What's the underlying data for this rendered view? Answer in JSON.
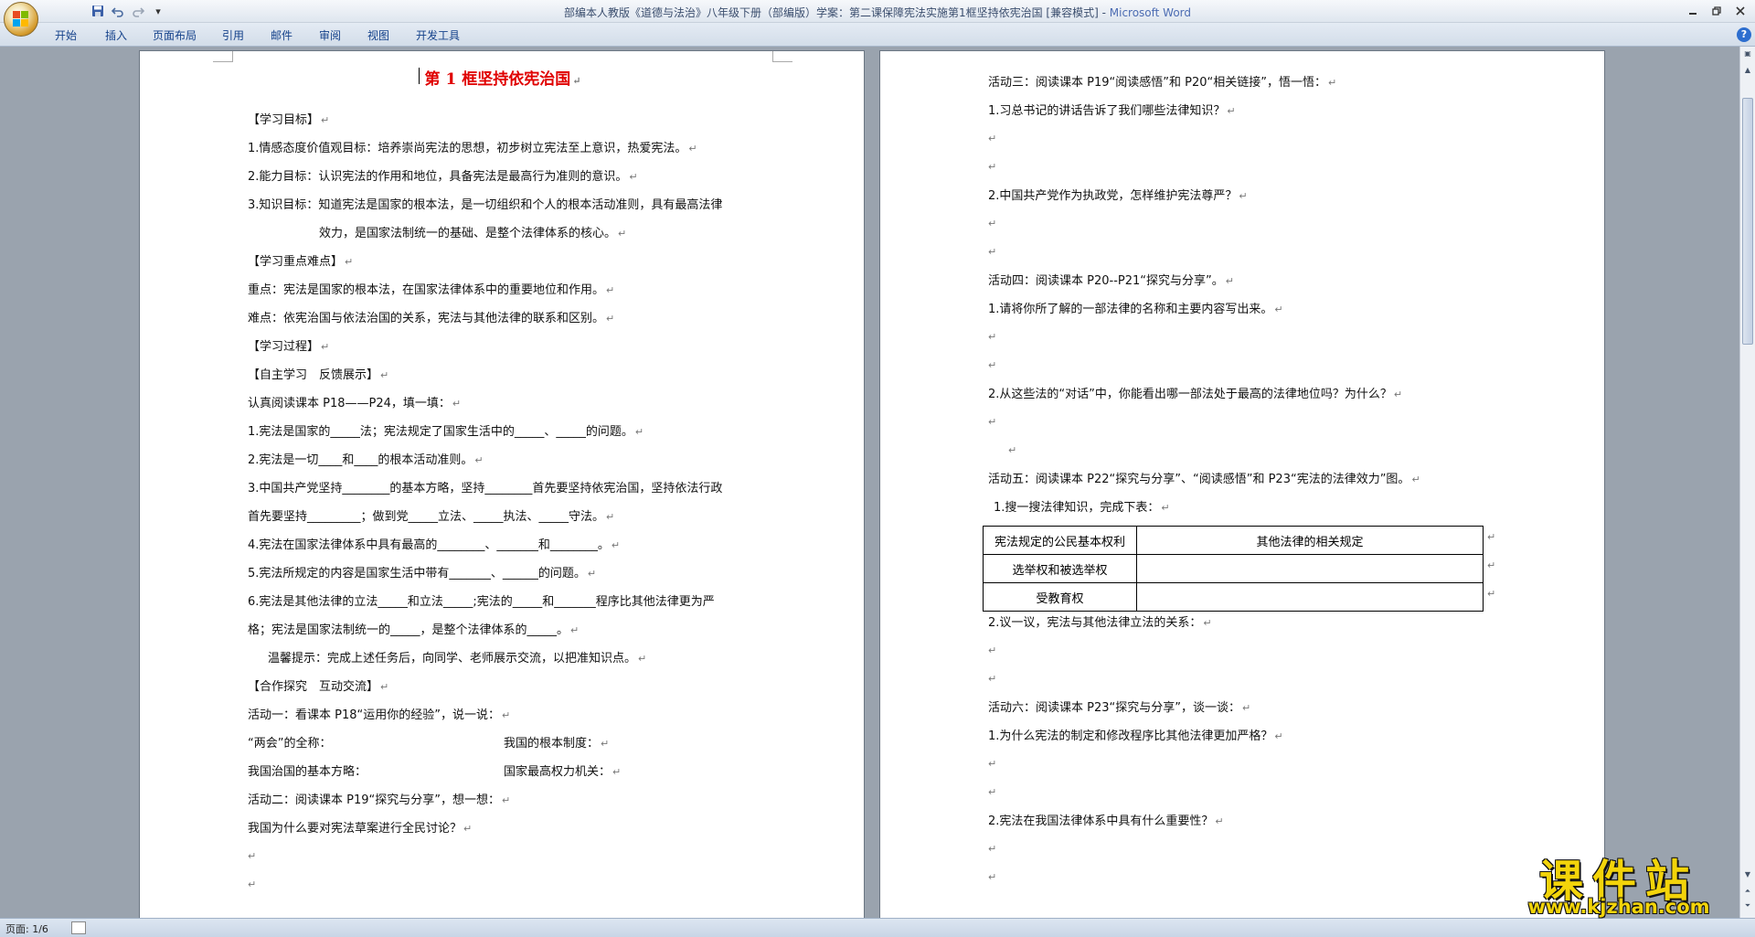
{
  "window": {
    "title_doc": "部编本人教版《道德与法治》八年级下册（部编版）学案：第二课保障宪法实施第1框坚持依宪治国 [兼容模式]",
    "title_sep": " - ",
    "title_app": "Microsoft Word"
  },
  "ribbon": {
    "tabs": [
      "开始",
      "插入",
      "页面布局",
      "引用",
      "邮件",
      "审阅",
      "视图",
      "开发工具"
    ]
  },
  "status": {
    "page": "页面: 1/6"
  },
  "page1": {
    "title": "第 1 框坚持依宪治国",
    "lines": [
      "【学习目标】",
      "1.情感态度价值观目标：培养崇尚宪法的思想，初步树立宪法至上意识，热爱宪法。",
      "2.能力目标：认识宪法的作用和地位，具备宪法是最高行为准则的意识。",
      "3.知识目标：知道宪法是国家的根本法，是一切组织和个人的根本活动准则，具有最高法律",
      "效力，是国家法制统一的基础、是整个法律体系的核心。",
      "【学习重点难点】",
      "重点：宪法是国家的根本法，在国家法律体系中的重要地位和作用。",
      "难点：依宪治国与依法治国的关系，宪法与其他法律的联系和区别。",
      "【学习过程】",
      "【自主学习　反馈展示】",
      "认真阅读课本 P18——P24，填一填：",
      "1.宪法是国家的_____法；宪法规定了国家生活中的_____、_____的问题。",
      "2.宪法是一切____和____的根本活动准则。",
      "3.中国共产党坚持________的基本方略，坚持________首先要坚持依宪治国，坚持依法行政",
      "首先要坚持_________；做到党_____立法、_____执法、_____守法。",
      "4.宪法在国家法律体系中具有最高的________、_______和________。",
      "5.宪法所规定的内容是国家生活中带有_______、______的问题。",
      "6.宪法是其他法律的立法_____和立法_____;宪法的_____和_______程序比其他法律更为严",
      "格；宪法是国家法制统一的_____，是整个法律体系的_____。",
      "温馨提示：完成上述任务后，向同学、老师展示交流，以把准知识点。",
      "【合作探究　互动交流】",
      "活动一：看课本 P18“运用你的经验”，说一说：",
      "“两会”的全称：",
      "我国的根本制度：",
      "我国治国的基本方略：",
      "国家最高权力机关：",
      "活动二：阅读课本 P19“探究与分享”，想一想：",
      "我国为什么要对宪法草案进行全民讨论？"
    ]
  },
  "page2": {
    "lines": [
      "活动三：阅读课本 P19“阅读感悟”和 P20“相关链接”，悟一悟：",
      "1.习总书记的讲话告诉了我们哪些法律知识？",
      "2.中国共产党作为执政党，怎样维护宪法尊严？",
      "活动四：阅读课本 P20--P21“探究与分享”。",
      "1.请将你所了解的一部法律的名称和主要内容写出来。",
      "2.从这些法的“对话”中，你能看出哪一部法处于最高的法律地位吗？为什么？",
      "活动五：阅读课本 P22“探究与分享”、“阅读感悟”和 P23“宪法的法律效力”图。",
      "1.搜一搜法律知识，完成下表：",
      "2.议一议，宪法与其他法律立法的关系：",
      "活动六：阅读课本 P23“探究与分享”，谈一谈：",
      "1.为什么宪法的制定和修改程序比其他法律更加严格？",
      "2.宪法在我国法律体系中具有什么重要性？"
    ],
    "table": {
      "headers": [
        "宪法规定的公民基本权利",
        "其他法律的相关规定"
      ],
      "rows": [
        [
          "选举权和被选举权",
          ""
        ],
        [
          "受教育权",
          ""
        ]
      ]
    }
  },
  "marks": {
    "paragraph": "↵"
  },
  "watermark": {
    "main": "课件站",
    "url": "www.kjzhan.com"
  },
  "icons": {
    "office": "office-button-icon",
    "save": "save-icon",
    "undo": "undo-icon",
    "redo": "redo-icon",
    "customize": "customize-qat-icon",
    "minimize": "minimize-icon",
    "restore": "restore-icon",
    "close": "close-icon",
    "help": "help-icon"
  },
  "colors": {
    "title_red": "#e00000",
    "ribbon_text": "#15428b",
    "watermark": "#f3d40a"
  }
}
